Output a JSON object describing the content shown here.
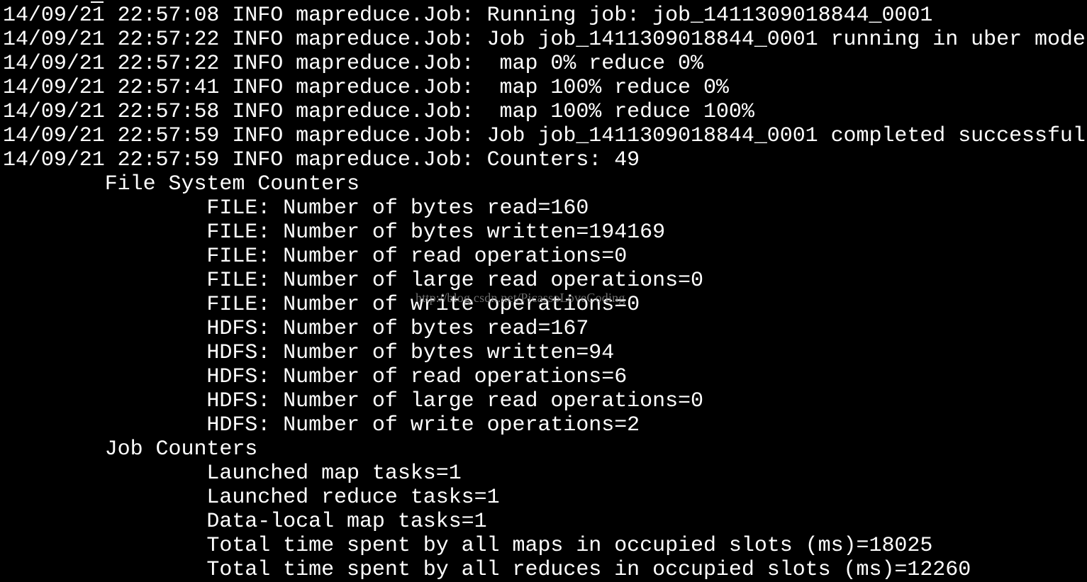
{
  "terminal": {
    "lines": [
      "14/09/21 22:57:08 INFO mapreduce.Job: Running job: job_1411309018844_0001",
      "14/09/21 22:57:22 INFO mapreduce.Job: Job job_1411309018844_0001 running in uber mode",
      "14/09/21 22:57:22 INFO mapreduce.Job:  map 0% reduce 0%",
      "14/09/21 22:57:41 INFO mapreduce.Job:  map 100% reduce 0%",
      "14/09/21 22:57:58 INFO mapreduce.Job:  map 100% reduce 100%",
      "14/09/21 22:57:59 INFO mapreduce.Job: Job job_1411309018844_0001 completed successful",
      "14/09/21 22:57:59 INFO mapreduce.Job: Counters: 49",
      "        File System Counters",
      "                FILE: Number of bytes read=160",
      "                FILE: Number of bytes written=194169",
      "                FILE: Number of read operations=0",
      "                FILE: Number of large read operations=0",
      "                FILE: Number of write operations=0",
      "                HDFS: Number of bytes read=167",
      "                HDFS: Number of bytes written=94",
      "                HDFS: Number of read operations=6",
      "                HDFS: Number of large read operations=0",
      "                HDFS: Number of write operations=2",
      "        Job Counters",
      "                Launched map tasks=1",
      "                Launched reduce tasks=1",
      "                Data-local map tasks=1",
      "                Total time spent by all maps in occupied slots (ms)=18025",
      "                Total time spent by all reduces in occupied slots (ms)=12260"
    ],
    "watermark": "http://blog.csdn.net/PicassoLoveCoding",
    "colors": {
      "background": "#000000",
      "foreground": "#ffffff",
      "watermark": "#8a8a8a"
    }
  }
}
